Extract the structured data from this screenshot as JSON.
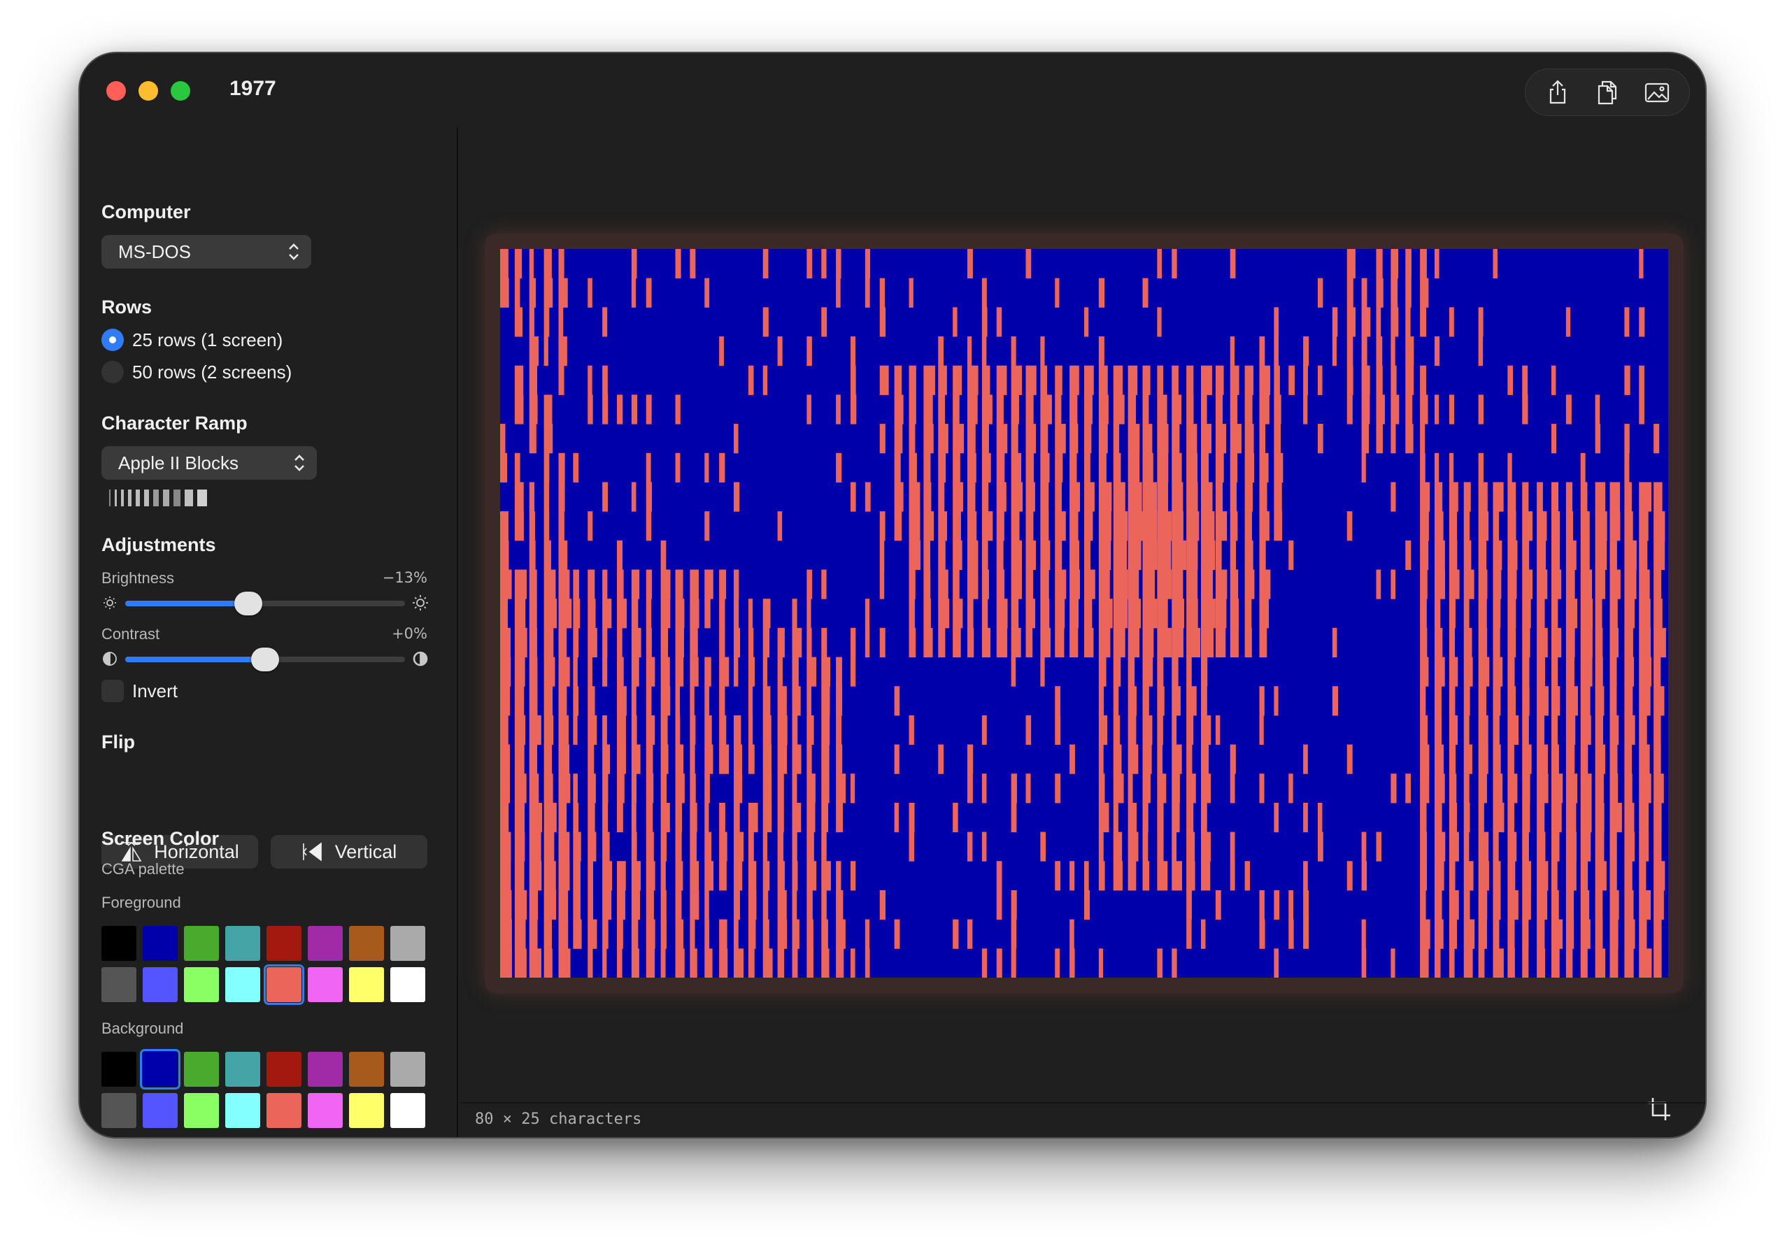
{
  "window": {
    "title": "1977"
  },
  "toolbar": {
    "icons": [
      "share-icon",
      "copy-icon",
      "image-icon"
    ]
  },
  "sidebar": {
    "computer": {
      "heading": "Computer",
      "selected": "MS-DOS"
    },
    "rows": {
      "heading": "Rows",
      "options": [
        {
          "label": "25 rows (1 screen)",
          "selected": true
        },
        {
          "label": "50 rows (2 screens)",
          "selected": false
        }
      ]
    },
    "ramp": {
      "heading": "Character Ramp",
      "selected": "Apple II Blocks"
    },
    "adjustments": {
      "heading": "Adjustments",
      "brightness": {
        "label": "Brightness",
        "value_text": "−13%",
        "level": 0.44
      },
      "contrast": {
        "label": "Contrast",
        "value_text": "+0%",
        "level": 0.5
      },
      "invert": {
        "label": "Invert",
        "checked": false
      }
    },
    "flip": {
      "heading": "Flip",
      "horizontal": "Horizontal",
      "vertical": "Vertical"
    },
    "screen_color": {
      "heading": "Screen Color",
      "palette_label": "CGA palette",
      "foreground_label": "Foreground",
      "background_label": "Background",
      "palette": [
        "#000000",
        "#0000aa",
        "#4aaa2e",
        "#45a4a6",
        "#a3180f",
        "#a12aa6",
        "#a65b1c",
        "#aaaaaa",
        "#555555",
        "#5555ff",
        "#8aff64",
        "#84ffff",
        "#eb655b",
        "#f065f4",
        "#ffff6a",
        "#ffffff"
      ],
      "foreground_selected": 12,
      "background_selected": 1
    }
  },
  "preview": {
    "foreground": "#eb655b",
    "background": "#0000aa"
  },
  "status": {
    "text": "80 × 25 characters"
  }
}
